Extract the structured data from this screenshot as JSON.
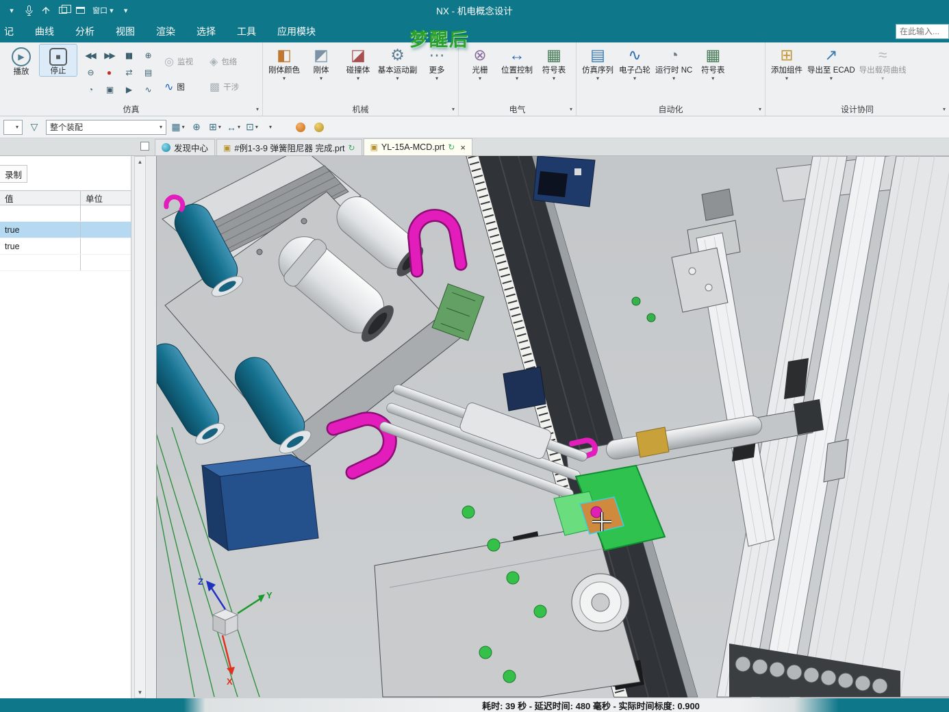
{
  "title_bar": {
    "title": "NX - 机电概念设计",
    "window_menu": "窗口"
  },
  "menu_bar": {
    "items": [
      "记",
      "曲线",
      "分析",
      "视图",
      "渲染",
      "选择",
      "工具",
      "应用模块"
    ],
    "search_placeholder": "在此输入..."
  },
  "ribbon": {
    "simulation": {
      "label": "仿真",
      "play": "播放",
      "stop": "停止",
      "side_buttons": [
        {
          "label": "监视"
        },
        {
          "label": "包络"
        },
        {
          "label": "图"
        },
        {
          "label": "干涉"
        }
      ]
    },
    "mechanical": {
      "label": "机械",
      "buttons": [
        "刚体颜色",
        "刚体",
        "碰撞体",
        "基本运动副",
        "更多"
      ]
    },
    "electrical": {
      "label": "电气",
      "buttons": [
        "光栅",
        "位置控制",
        "符号表"
      ]
    },
    "automation": {
      "label": "自动化",
      "buttons": [
        "仿真序列",
        "电子凸轮",
        "运行时 NC",
        "符号表"
      ]
    },
    "collaboration": {
      "label": "设计协同",
      "buttons": [
        "添加组件",
        "导出至 ECAD",
        "导出载荷曲线"
      ]
    }
  },
  "assembly_bar": {
    "scope": "整个装配"
  },
  "tab_bar": {
    "tabs": [
      {
        "label": "发现中心"
      },
      {
        "label": "#例1-3-9 弹簧阻尼器 完成.prt"
      },
      {
        "label": "YL-15A-MCD.prt"
      }
    ]
  },
  "left_panel": {
    "tab": "录制",
    "columns": {
      "value": "值",
      "unit": "单位"
    },
    "rows": [
      {
        "value": "",
        "unit": ""
      },
      {
        "value": "true",
        "unit": ""
      },
      {
        "value": "true",
        "unit": ""
      }
    ]
  },
  "viewport": {
    "watermark": "梦醒后",
    "triad": {
      "x": "X",
      "y": "Y",
      "z": "Z"
    }
  },
  "status_bar": {
    "text": "耗时:  39 秒 - 延迟时间:  480 毫秒 - 实际时间标度:  0.900"
  },
  "icons": {
    "dropdown": "▾",
    "play": "▶",
    "stop": "■",
    "monitor": "◎",
    "envelope": "◈",
    "chart": "∿",
    "interference": "▩",
    "rigid_color": "◧",
    "rigid": "◩",
    "collision": "◪",
    "joint": "⚙",
    "more": "⋯",
    "raster": "⊗",
    "position_ctrl": "↔",
    "symbol_table": "▦",
    "sim_sequence": "▤",
    "cam": "∿",
    "runtime_nc": "◔",
    "add_component": "⊞",
    "export_ecad": "↗",
    "export_load": "≈",
    "funnel": "▽",
    "up": "▲",
    "down": "▼",
    "close": "×",
    "refresh": "↻",
    "part": "▣",
    "sim_small": [
      "◀◀",
      "▶▶",
      "▮▮",
      "⊕",
      "⊖",
      "●",
      "⇄",
      "▤",
      "◔",
      "▣",
      "▶",
      "∿"
    ],
    "asm": [
      "▦",
      "⊕",
      "⊞",
      "↔",
      "⊡"
    ]
  }
}
